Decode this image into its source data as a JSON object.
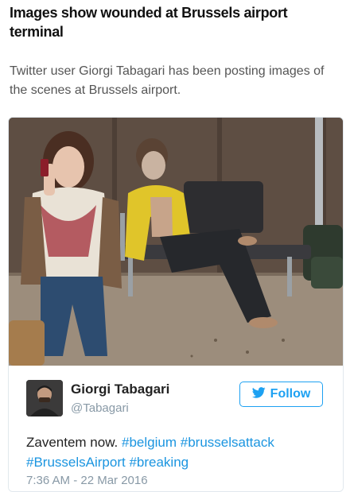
{
  "article": {
    "headline": "Images show wounded at Brussels airport terminal",
    "lead": "Twitter user Giorgi Tabagari has been posting images of the scenes at Brussels airport."
  },
  "tweet": {
    "author_name": "Giorgi Tabagari",
    "author_handle": "@Tabagari",
    "follow_label": "Follow",
    "text_plain": "Zaventem now.",
    "hashtags": [
      "#belgium",
      "#brusselsattack",
      "#BrusselsAirport",
      "#breaking"
    ],
    "timestamp": "7:36 AM - 22 Mar 2016"
  },
  "colors": {
    "link": "#1b95e0",
    "follow_border": "#1da1f2",
    "muted": "#8899a6"
  },
  "icons": {
    "follow": "twitter-bird-icon"
  }
}
